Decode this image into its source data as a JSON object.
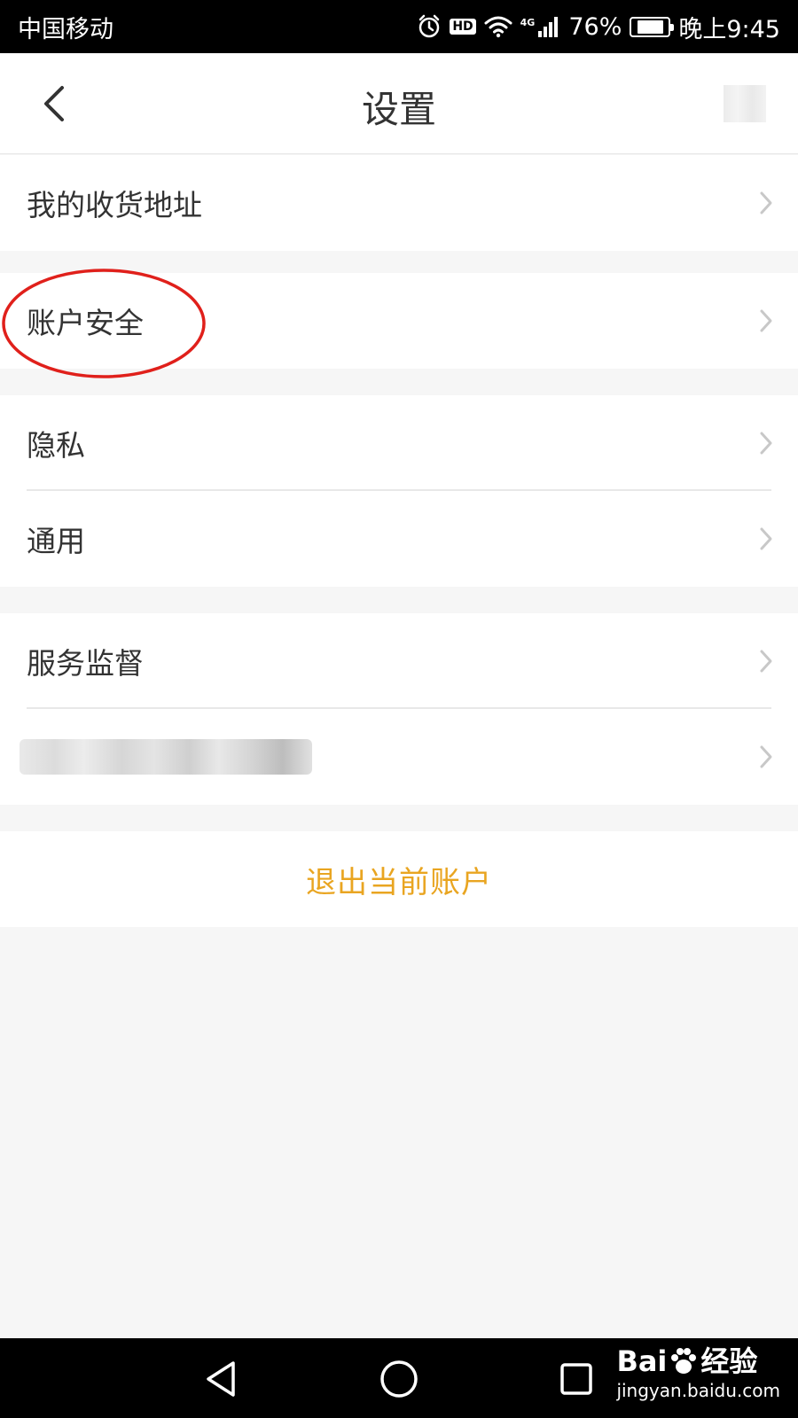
{
  "status_bar": {
    "carrier": "中国移动",
    "hd_badge": "HD",
    "network_type": "4G",
    "battery_percent": "76%",
    "battery_level": 0.76,
    "time": "晚上9:45",
    "icons": [
      "alarm-icon",
      "hd-icon",
      "wifi-icon",
      "signal-icon",
      "battery-icon"
    ]
  },
  "header": {
    "title": "设置",
    "back_icon": "chevron-left-icon"
  },
  "groups": [
    {
      "items": [
        {
          "label": "我的收货地址"
        }
      ]
    },
    {
      "items": [
        {
          "label": "账户安全",
          "highlighted": true
        }
      ]
    },
    {
      "items": [
        {
          "label": "隐私"
        },
        {
          "label": "通用"
        }
      ]
    },
    {
      "items": [
        {
          "label": "服务监督"
        },
        {
          "label": "",
          "blurred": true
        }
      ]
    }
  ],
  "logout": {
    "label": "退出当前账户"
  },
  "colors": {
    "accent": "#e9a521",
    "highlight_ring": "#e0201b",
    "background": "#f6f6f6",
    "text": "#333333"
  },
  "nav_bar": {
    "buttons": [
      "back-triangle-icon",
      "home-circle-icon",
      "recents-square-icon"
    ]
  },
  "watermark": {
    "brand": "Bai",
    "brand_suffix": "经验",
    "url": "jingyan.baidu.com"
  }
}
